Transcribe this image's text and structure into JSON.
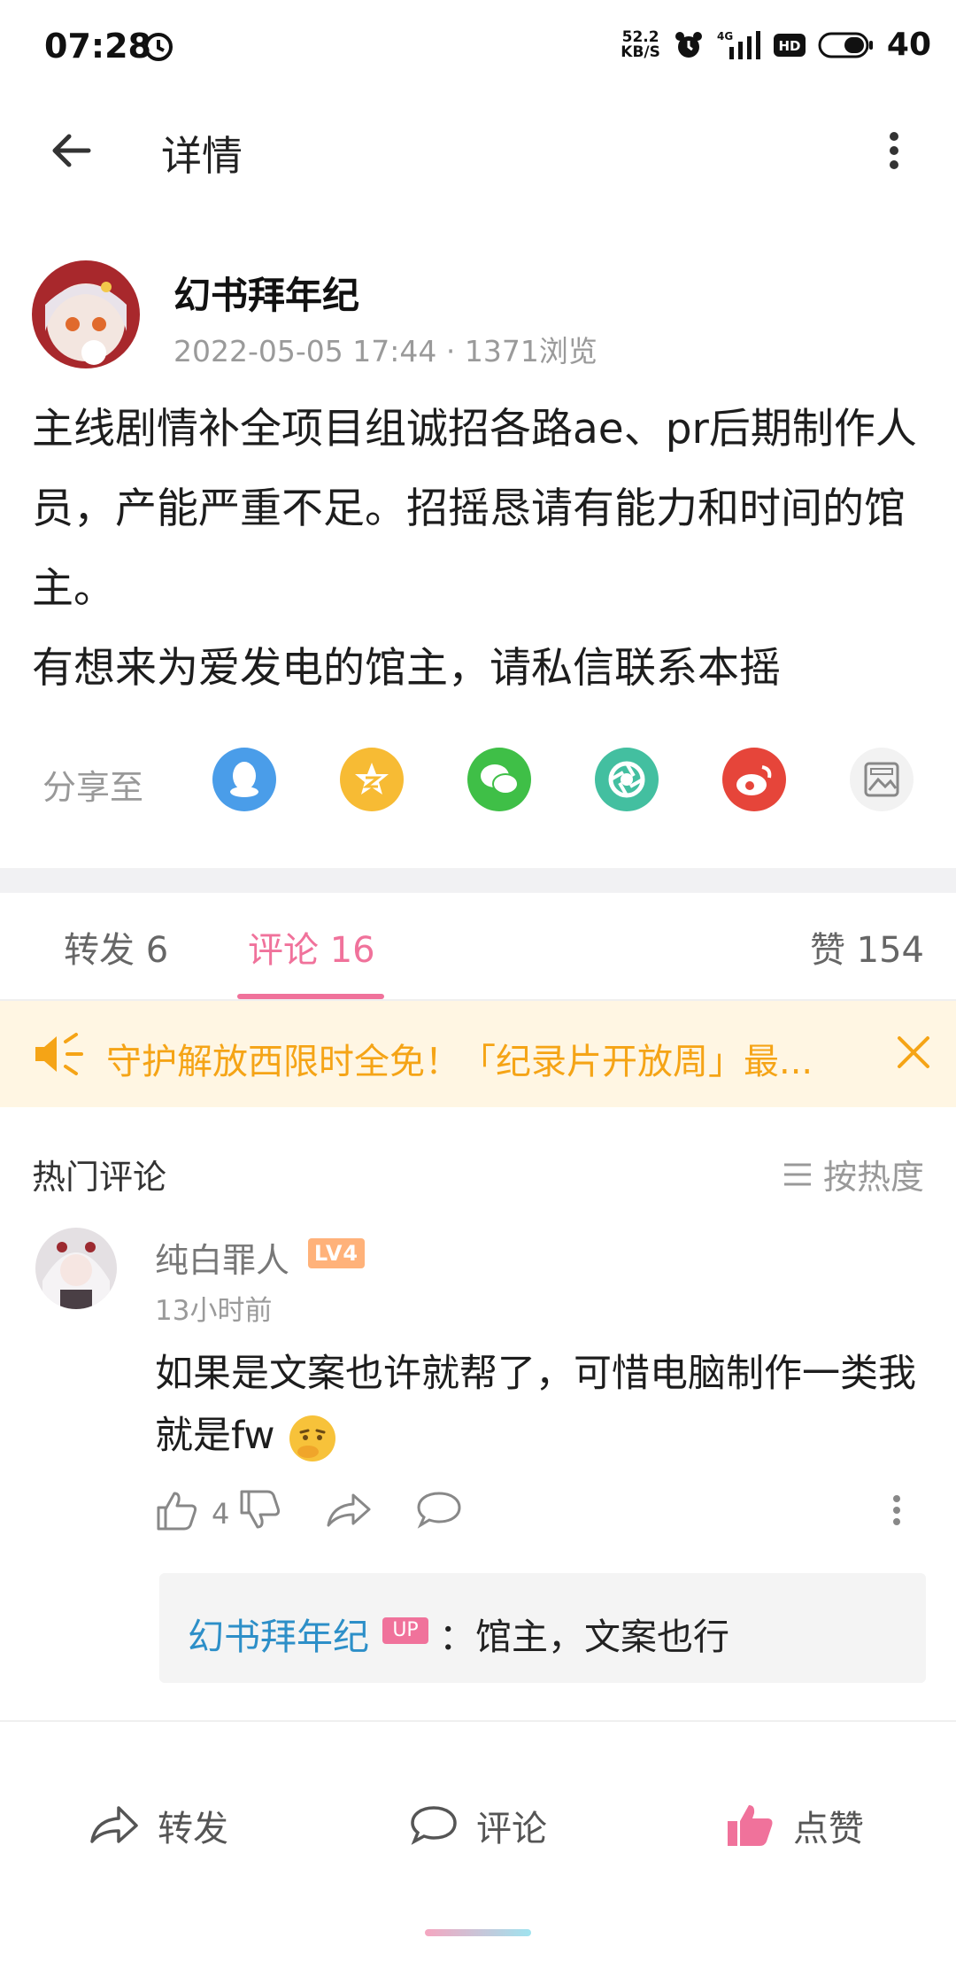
{
  "status_bar": {
    "time": "07:28",
    "net_speed_value": "52.2",
    "net_speed_unit": "KB/S",
    "signal_label": "4G",
    "hd_label": "HD",
    "battery": "40"
  },
  "header": {
    "title": "详情"
  },
  "post": {
    "author": "幻书拜年纪",
    "meta": "2022-05-05 17:44 · 1371浏览",
    "paragraphs": [
      "主线剧情补全项目组诚招各路ae、pr后期制作人员，产能严重不足。招摇恳请有能力和时间的馆主。",
      "有想来为爱发电的馆主，请私信联系本摇"
    ]
  },
  "share": {
    "label": "分享至",
    "targets": [
      {
        "name": "qq-icon",
        "color": "#4a9de9"
      },
      {
        "name": "qzone-icon",
        "color": "#f7bb34"
      },
      {
        "name": "wechat-icon",
        "color": "#3fbf47"
      },
      {
        "name": "moments-icon",
        "color": "#43bfa0"
      },
      {
        "name": "weibo-icon",
        "color": "#e6453a"
      },
      {
        "name": "image-share-icon",
        "color": "#f2f2f2"
      }
    ]
  },
  "tabs": {
    "repost": "转发 6",
    "comments": "评论 16",
    "likes": "赞 154",
    "accent": "#f0729b"
  },
  "notice": {
    "text": "守护解放西限时全免！「纪录片开放周」最..."
  },
  "comments_section": {
    "title": "热门评论",
    "sort_label": "按热度"
  },
  "comment": {
    "user": "纯白罪人",
    "level": "LV4",
    "time": "13小时前",
    "text": "如果是文案也许就帮了，可惜电脑制作一类我就是fw",
    "like_count": "4",
    "reply": {
      "user": "幻书拜年纪",
      "badge": "UP",
      "text": "：馆主，文案也行"
    }
  },
  "bottom_bar": {
    "repost": "转发",
    "comment": "评论",
    "like": "点赞"
  }
}
